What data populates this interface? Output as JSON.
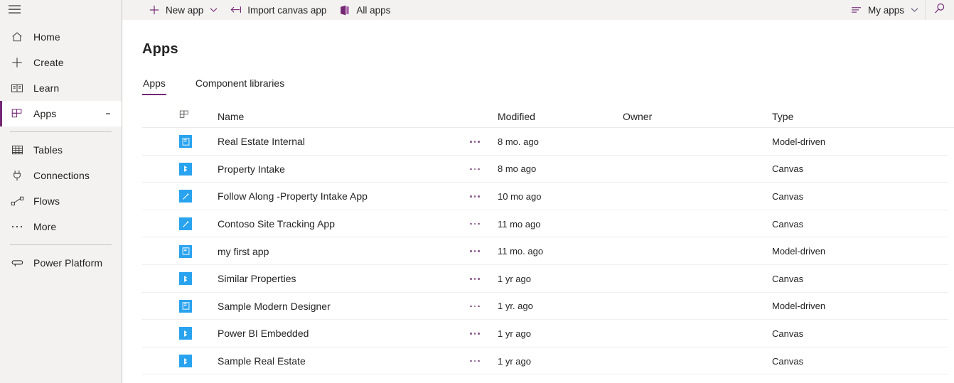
{
  "colors": {
    "accent_purple": "#742774",
    "sidebar_bg": "#f3f2f1",
    "app_icon_blue": "#2aa3ef",
    "text": "#242424"
  },
  "sidebar": {
    "hamburger_label": "Menu",
    "items": [
      {
        "id": "home",
        "label": "Home",
        "icon": "home-icon",
        "selected": false
      },
      {
        "id": "create",
        "label": "Create",
        "icon": "plus-icon",
        "selected": false
      },
      {
        "id": "learn",
        "label": "Learn",
        "icon": "book-icon",
        "selected": false
      },
      {
        "id": "apps",
        "label": "Apps",
        "icon": "apps-grid-icon",
        "selected": true,
        "has_overflow": true
      }
    ],
    "items2": [
      {
        "id": "tables",
        "label": "Tables",
        "icon": "table-icon"
      },
      {
        "id": "connections",
        "label": "Connections",
        "icon": "plug-icon"
      },
      {
        "id": "flows",
        "label": "Flows",
        "icon": "flow-icon"
      },
      {
        "id": "more",
        "label": "More",
        "icon": "ellipsis-icon"
      }
    ],
    "items3": [
      {
        "id": "power-platform",
        "label": "Power Platform",
        "icon": "power-platform-icon"
      }
    ]
  },
  "command_bar": {
    "new_app": {
      "label": "New app",
      "icon": "plus-icon",
      "chevron": "chevron-down-icon"
    },
    "import_canvas_app": {
      "label": "Import canvas app",
      "icon": "import-arrow-icon"
    },
    "all_apps": {
      "label": "All apps",
      "icon": "all-apps-icon"
    },
    "my_apps": {
      "label": "My apps",
      "icon": "filter-lines-icon",
      "chevron": "chevron-down-icon"
    },
    "search": {
      "icon": "search-icon",
      "label": "Search"
    }
  },
  "page": {
    "title": "Apps",
    "tabs": [
      {
        "id": "apps",
        "label": "Apps",
        "active": true
      },
      {
        "id": "component-libraries",
        "label": "Component libraries",
        "active": false
      }
    ]
  },
  "table": {
    "columns": [
      {
        "id": "icon",
        "label": "",
        "icon": "apps-grid-icon"
      },
      {
        "id": "name",
        "label": "Name"
      },
      {
        "id": "modified",
        "label": "Modified"
      },
      {
        "id": "owner",
        "label": "Owner"
      },
      {
        "id": "type",
        "label": "Type"
      }
    ],
    "rows": [
      {
        "name": "Real Estate Internal",
        "modified": "8 mo. ago",
        "owner": "",
        "type": "Model-driven",
        "icon": "model-driven-app-icon"
      },
      {
        "name": "Property Intake",
        "modified": "8 mo ago",
        "owner": "",
        "type": "Canvas",
        "icon": "canvas-app-icon"
      },
      {
        "name": "Follow Along -Property Intake App",
        "modified": "10 mo ago",
        "owner": "",
        "type": "Canvas",
        "icon": "pen-app-icon"
      },
      {
        "name": "Contoso Site Tracking App",
        "modified": "11 mo ago",
        "owner": "",
        "type": "Canvas",
        "icon": "pen-app-icon"
      },
      {
        "name": "my first app",
        "modified": "11 mo. ago",
        "owner": "",
        "type": "Model-driven",
        "icon": "model-driven-app-icon"
      },
      {
        "name": "Similar Properties",
        "modified": "1 yr ago",
        "owner": "",
        "type": "Canvas",
        "icon": "canvas-app-icon"
      },
      {
        "name": "Sample Modern Designer",
        "modified": "1 yr. ago",
        "owner": "",
        "type": "Model-driven",
        "icon": "model-driven-app-icon"
      },
      {
        "name": "Power BI Embedded",
        "modified": "1 yr ago",
        "owner": "",
        "type": "Canvas",
        "icon": "canvas-app-icon"
      },
      {
        "name": "Sample Real Estate",
        "modified": "1 yr ago",
        "owner": "",
        "type": "Canvas",
        "icon": "canvas-app-icon"
      }
    ]
  }
}
